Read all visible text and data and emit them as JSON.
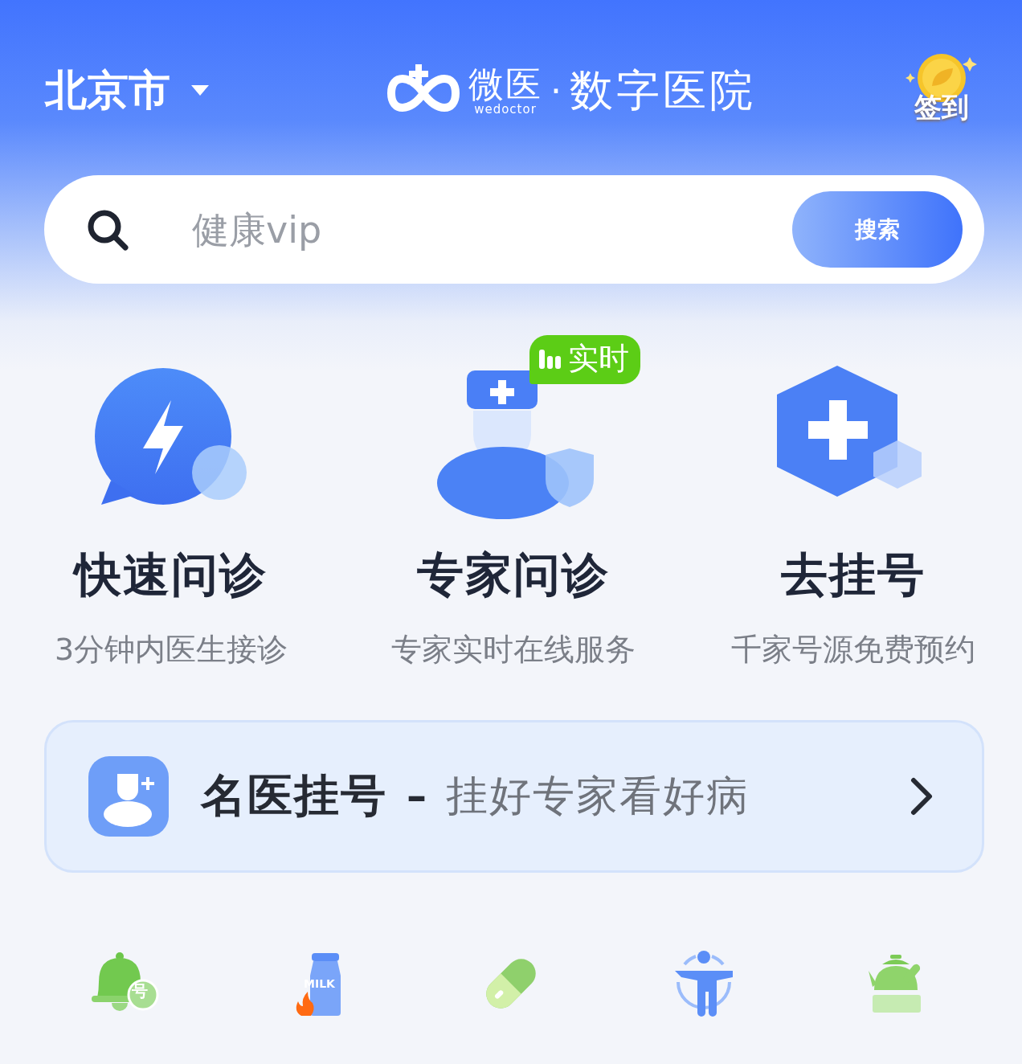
{
  "header": {
    "city": "北京市",
    "logo": {
      "brand": "微医",
      "brand_sub": "wedoctor",
      "separator": "·",
      "name": "数字医院"
    },
    "checkin": "签到"
  },
  "search": {
    "placeholder": "健康vip",
    "button": "搜索"
  },
  "services": [
    {
      "kind": "quick",
      "title": "快速问诊",
      "subtitle": "3分钟内医生接诊"
    },
    {
      "kind": "expert",
      "title": "专家问诊",
      "subtitle": "专家实时在线服务",
      "badge": "实时"
    },
    {
      "kind": "register",
      "title": "去挂号",
      "subtitle": "千家号源免费预约"
    }
  ],
  "banner": {
    "title": "名医挂号",
    "dash": "–",
    "subtitle": "挂好专家看好病"
  },
  "shortcuts": [
    {
      "kind": "bell",
      "label": "号"
    },
    {
      "kind": "milk",
      "label": "MILK"
    },
    {
      "kind": "pill"
    },
    {
      "kind": "posture"
    },
    {
      "kind": "teapot"
    }
  ]
}
